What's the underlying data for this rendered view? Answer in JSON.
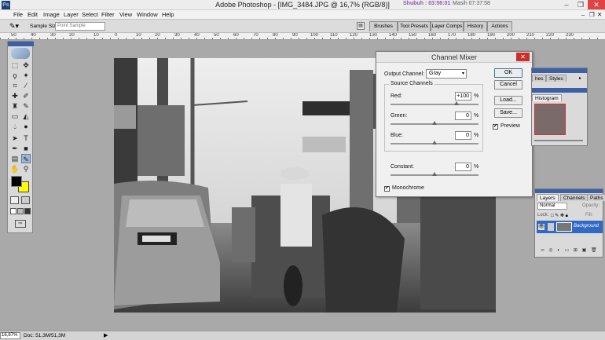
{
  "window": {
    "title": "Adobe Photoshop - [IMG_3484.JPG @ 16,7% (RGB/8)]",
    "app_logo": "Ps",
    "clock_prefix": "Shubuh : ",
    "clock_time": "03:56:01",
    "clock_suffix": "Masih 07:37:58",
    "controls": {
      "minimize": "–",
      "restore": "❐",
      "close": "✕"
    }
  },
  "menu": [
    "File",
    "Edit",
    "Image",
    "Layer",
    "Select",
    "Filter",
    "View",
    "Window",
    "Help"
  ],
  "options_bar": {
    "sample_size_label": "Sample Size:",
    "sample_size_value": "Point Sample",
    "palette_tabs": [
      "Brushes",
      "Tool Presets",
      "Layer Comps",
      "History",
      "Actions"
    ]
  },
  "ruler": {
    "labels": [
      "50",
      "40",
      "30",
      "20",
      "10",
      "0",
      "10",
      "20",
      "30",
      "40",
      "50",
      "60",
      "70",
      "80",
      "90",
      "100",
      "110",
      "120",
      "130",
      "140",
      "150",
      "160",
      "170",
      "180",
      "190",
      "200",
      "210",
      "220",
      "230"
    ]
  },
  "dialog": {
    "title": "Channel Mixer",
    "output_channel_label": "Output Channel:",
    "output_channel_value": "Gray",
    "source_channels_label": "Source Channels",
    "red_label": "Red:",
    "red_value": "+100",
    "red_level": 100,
    "green_label": "Green:",
    "green_value": "0",
    "green_level": 0,
    "blue_label": "Blue:",
    "blue_value": "0",
    "blue_level": 0,
    "constant_label": "Constant:",
    "constant_value": "0",
    "constant_level": 0,
    "percent": "%",
    "monochrome_label": "Monochrome",
    "monochrome_checked": true,
    "preview_label": "Preview",
    "preview_checked": true,
    "buttons": {
      "ok": "OK",
      "cancel": "Cancel",
      "load": "Load...",
      "save": "Save..."
    }
  },
  "navigator_panel": {
    "tabs": [
      "hes",
      "Styles"
    ],
    "histogram_tab": "Histogram"
  },
  "layers_panel": {
    "tabs": [
      "Layers",
      "Channels",
      "Paths"
    ],
    "blend_mode": "Normal",
    "opacity_label": "Opacity:",
    "lock_label": "Lock:",
    "fill_label": "Fill:",
    "layer_name": "Background"
  },
  "status_bar": {
    "zoom": "16,67%",
    "doc_info": "Doc: 51,3M/51,3M"
  },
  "colors": {
    "foreground": "#000000",
    "background": "#ffff00",
    "panel_grip": "#3d60a4",
    "layer_selected": "#316ac5",
    "close_red": "#c9302c"
  }
}
